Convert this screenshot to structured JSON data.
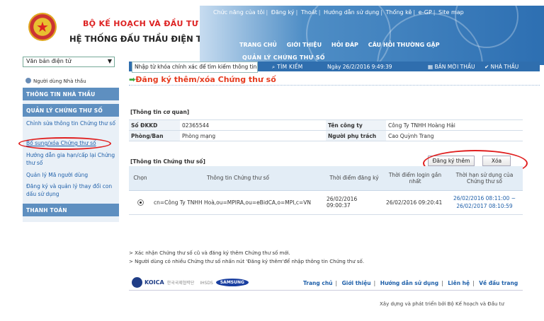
{
  "header": {
    "ministry": "BỘ KẾ HOẠCH VÀ ĐẦU TƯ",
    "system_name": "HỆ THỐNG ĐẤU THẦU ĐIỆN TỬ",
    "top_menu": [
      "Chức năng của tôi",
      "Đăng ký",
      "Thoát",
      "Hướng dẫn sử dụng",
      "Thống kê",
      "e-GP",
      "Site map"
    ],
    "main_nav": [
      "TRANG CHỦ",
      "GIỚI THIỆU",
      "HỎI ĐÁP",
      "CÂU HỎI THƯỜNG GẶP"
    ],
    "sub_nav": "QUẢN LÝ CHỨNG THƯ SỐ"
  },
  "search": {
    "placeholder": "Nhập từ khóa chính xác để tìm kiếm thông tin",
    "button_label": "TÌM KIẾM",
    "datetime": "Ngày 26/2/2016 9:49:39",
    "new_bid_label": "BẢN MỜI THẦU",
    "bidder_label": "NHÀ THẦU"
  },
  "sidebar": {
    "doc_select": "Văn bản điện tử",
    "user_label": "Người dùng Nhà thầu",
    "sections": [
      "THÔNG TIN NHÀ THẦU",
      "QUẢN LÝ CHỨNG THƯ SỐ",
      "THANH TOÁN"
    ],
    "items": [
      "Chỉnh sửa thông tin Chứng thư số",
      "Bổ sung/xóa Chứng thư số",
      "Hướng dẫn gia hạn/cấp lại Chứng thư số",
      "Quản lý Mã người dùng",
      "Đăng ký và quản lý thay đổi con dấu sử dụng"
    ]
  },
  "main": {
    "title": "Đăng ký thêm/xóa Chứng thư số",
    "org_section": "[Thông tin cơ quan]",
    "org": {
      "so_dkkd_label": "Số ĐKKD",
      "so_dkkd": "02365544",
      "company_label": "Tên công ty",
      "company": "Công Ty TNHH Hoàng Hải",
      "dept_label": "Phòng/Ban",
      "dept": "Phòng mạng",
      "person_label": "Người phụ trách",
      "person": "Cao Quỳnh Trang"
    },
    "cert_section": "[Thông tin Chứng thư số]",
    "register_button": "Đăng ký thêm",
    "delete_button": "Xóa",
    "cert_headers": [
      "Chọn",
      "Thông tin Chứng thư số",
      "Thời điểm đăng ký",
      "Thời điểm login gần nhất",
      "Thời hạn sử dụng của Chứng thư số"
    ],
    "cert_row": {
      "info": "cn=Công Ty TNHH Hoà,ou=MPIRA,ou=eBidCA,o=MPI,c=VN",
      "registered": "26/02/2016 09:00:37",
      "last_login": "26/02/2016 09:20:41",
      "validity": "26/02/2016 08:11:00 ~ 26/02/2017 08:10:59"
    },
    "notes": [
      "> Xác nhận Chứng thư số cũ và đăng ký thêm Chứng thư số mới.",
      "> Người dùng có nhiều Chứng thư số nhấn nút 'Đăng ký thêm'để nhập thông tin Chứng thư số."
    ]
  },
  "footer": {
    "logo_koica": "KOICA",
    "logo_small": "한국국제협력단",
    "logo_ihsds": "IHSDS",
    "logo_samsung": "SAMSUNG",
    "links": [
      "Trang chủ",
      "Giới thiệu",
      "Hướng dẫn sử dụng",
      "Liên hệ",
      "Về đầu trang"
    ],
    "credit": "Xây dựng và phát triển bởi Bộ Kế hoạch và Đầu tư"
  },
  "colors": {
    "accent_blue": "#2d6fb2",
    "title_red": "#e53b1f",
    "annotation_red": "#e02020",
    "link_blue": "#1e5fa9"
  }
}
